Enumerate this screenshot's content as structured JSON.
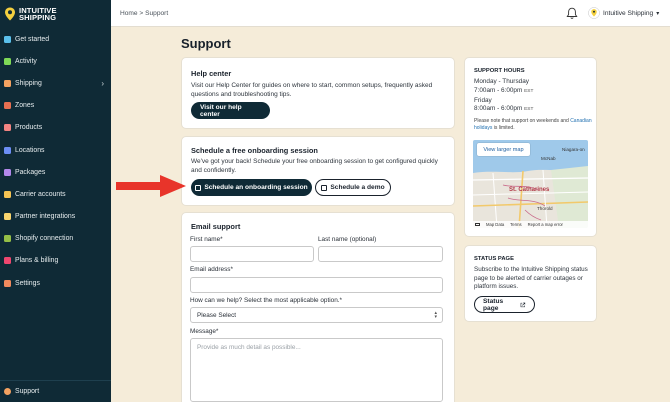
{
  "brand": {
    "line1": "INTUITIVE",
    "line2": "SHIPPING",
    "accent": "#f4d03f",
    "sidebar_bg": "#0f2a36"
  },
  "sidebar": {
    "items": [
      {
        "label": "Get started",
        "icon": "rocket-icon",
        "color": "#5bc0eb"
      },
      {
        "label": "Activity",
        "icon": "activity-icon",
        "color": "#7ed957"
      },
      {
        "label": "Shipping",
        "icon": "package-icon",
        "color": "#f4a261",
        "has_chevron": true
      },
      {
        "label": "Zones",
        "icon": "globe-icon",
        "color": "#e76f51"
      },
      {
        "label": "Products",
        "icon": "shirt-icon",
        "color": "#f28482"
      },
      {
        "label": "Locations",
        "icon": "location-icon",
        "color": "#6c8ef5"
      },
      {
        "label": "Packages",
        "icon": "box-icon",
        "color": "#b388eb"
      },
      {
        "label": "Carrier accounts",
        "icon": "key-icon",
        "color": "#f6c453"
      },
      {
        "label": "Partner integrations",
        "icon": "network-icon",
        "color": "#f9d56e"
      },
      {
        "label": "Shopify connection",
        "icon": "shopify-icon",
        "color": "#95bf47"
      },
      {
        "label": "Plans & billing",
        "icon": "card-icon",
        "color": "#ef476f"
      },
      {
        "label": "Settings",
        "icon": "gear-icon",
        "color": "#f08a5d"
      }
    ],
    "support_label": "Support"
  },
  "topbar": {
    "breadcrumb": "Home > Support",
    "account_name": "Intuitive Shipping",
    "caret": "▾"
  },
  "page": {
    "title": "Support"
  },
  "help_center": {
    "title": "Help center",
    "text": "Visit our Help Center for guides on where to start, common setups, frequently asked questions and troubleshooting tips.",
    "button": "Visit our help center"
  },
  "onboarding": {
    "title": "Schedule a free onboarding session",
    "text": "We've got your back! Schedule your free onboarding session to get configured quickly and confidently.",
    "primary_button": "Schedule an onboarding session",
    "secondary_button": "Schedule a demo"
  },
  "email_support": {
    "title": "Email support",
    "first_name_label": "First name*",
    "last_name_label": "Last name (optional)",
    "email_label": "Email address*",
    "topic_label": "How can we help? Select the most applicable option.*",
    "topic_selected": "Please Select",
    "message_label": "Message*",
    "message_placeholder": "Provide as much detail as possible..."
  },
  "support_hours": {
    "title": "SUPPORT HOURS",
    "days1": "Monday - Thursday",
    "time1": "7:00am - 6:00pm",
    "days2": "Friday",
    "time2": "8:00am - 6:00pm",
    "tz": "EST",
    "note_prefix": "Please note that support on weekends and",
    "note_link": "Canadian holidays",
    "note_suffix": "is limited.",
    "map_button": "View larger map",
    "map_city": "St. Catharines",
    "map_labels": [
      "McNab",
      "Niagara-on",
      "Thorold"
    ],
    "map_footer": [
      "Map Data",
      "Terms",
      "Report a map error"
    ]
  },
  "status_page": {
    "title": "STATUS PAGE",
    "text": "Subscribe to the Intuitive Shipping status page to be alerted of carrier outages or platform issues.",
    "button": "Status page"
  }
}
